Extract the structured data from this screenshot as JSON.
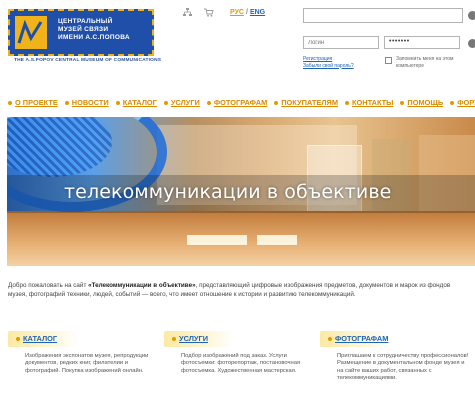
{
  "header": {
    "logo_lines": [
      "ЦЕНТРАЛЬНЫЙ",
      "МУЗЕЙ СВЯЗИ",
      "ИМЕНИ А.С.ПОПОВА"
    ],
    "logo_subtitle": "THE A.S.POPOV CENTRAL MUSEUM OF COMMUNICATIONS",
    "icons": [
      "sitemap-icon",
      "cart-icon"
    ],
    "lang_ru": "РУС",
    "lang_sep": "/",
    "lang_en": "ENG"
  },
  "auth": {
    "search_value": "",
    "login_placeholder": "Логин",
    "password_value": "•••••••",
    "register_link": "Регистрация",
    "forgot_link": "Забыли свой пароль?",
    "remember_label": "Запомнить меня на этом компьютере"
  },
  "nav": {
    "items": [
      {
        "label": "О ПРОЕКТЕ"
      },
      {
        "label": "НОВОСТИ"
      },
      {
        "label": "КАТАЛОГ"
      },
      {
        "label": "УСЛУГИ"
      },
      {
        "label": "ФОТОГРАФАМ"
      },
      {
        "label": "ПОКУПАТЕЛЯМ"
      },
      {
        "label": "КОНТАКТЫ"
      },
      {
        "label": "ПОМОЩЬ"
      },
      {
        "label": "ФОРУМ"
      }
    ]
  },
  "banner": {
    "title": "телекоммуникации в объективе"
  },
  "intro": {
    "prefix": "Добро пожаловать на сайт ",
    "site_name": "«Телекоммуникации в объективе»",
    "rest": ", представляющий цифровые изображения предметов, документов и марок из фондов музея, фотографий техники, людей, событий — всего, что имеет отношение к истории и развитию телекоммуникаций."
  },
  "cards": [
    {
      "title": "КАТАЛОГ",
      "text": "Изображения экспонатов музея, репродукции документов, редких книг, филателии и фотографий. Покупка изображений онлайн."
    },
    {
      "title": "УСЛУГИ",
      "text": "Подбор изображений под заказ. Услуги фотосъемки: фоторепортаж, постановочная фотосъемка. Художественная мастерская."
    },
    {
      "title": "ФОТОГРАФАМ",
      "text": "Приглашаем к сотрудничеству профессионалов! Размещение в документальном фонде музея и на сайте ваших работ, связанных с телекоммуникациями."
    }
  ],
  "colors": {
    "brand_blue": "#1f4fa8",
    "accent_orange": "#e39b00",
    "link_blue": "#1e63b6"
  }
}
